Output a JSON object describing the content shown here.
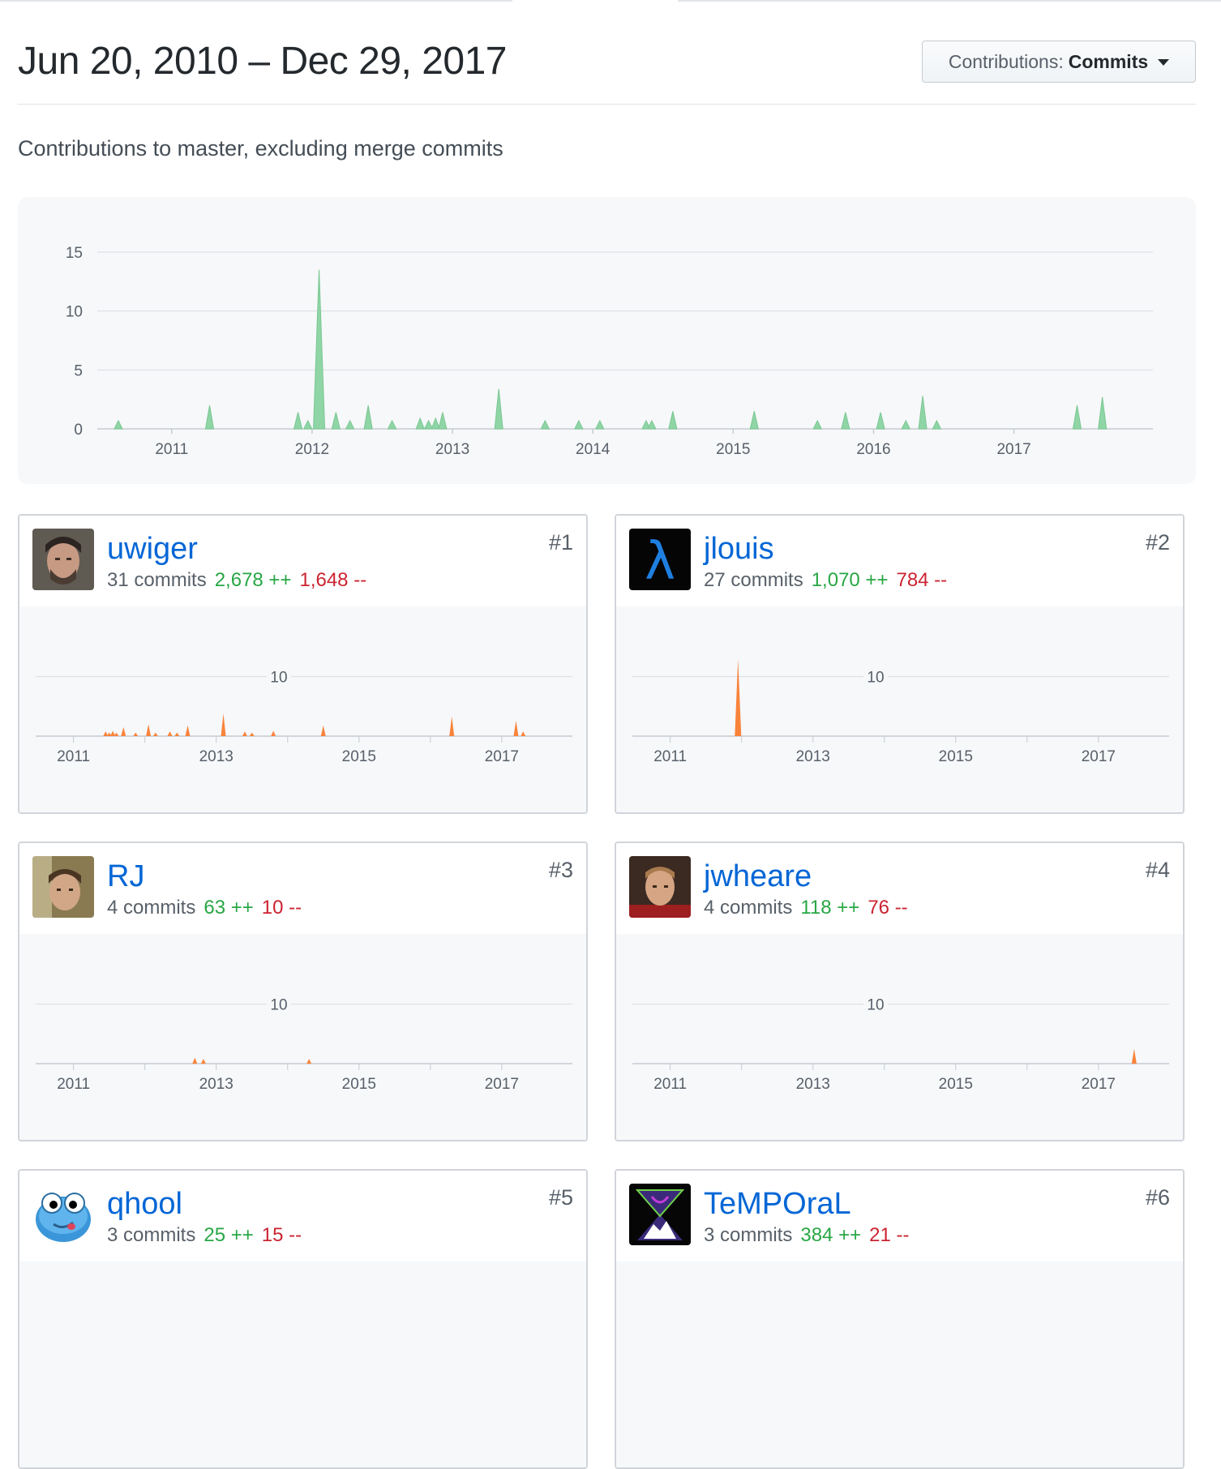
{
  "header": {
    "date_range": "Jun 20, 2010 – Dec 29, 2017",
    "select_prefix": "Contributions:",
    "select_value": "Commits",
    "subtitle": "Contributions to master, excluding merge commits"
  },
  "colors": {
    "main_area": "#8fd5a6",
    "main_stroke": "#7ac791",
    "contributor_area": "#f9833a",
    "link": "#0366d6",
    "additions": "#28a745",
    "deletions": "#cb2431"
  },
  "chart_data": [
    {
      "type": "area",
      "title": "",
      "ylim": [
        0,
        15
      ],
      "yticks": [
        0,
        5,
        10,
        15
      ],
      "xticks": [
        "2011",
        "2012",
        "2013",
        "2014",
        "2015",
        "2016",
        "2017"
      ],
      "xrange": [
        2010.47,
        2017.99
      ],
      "series": [
        {
          "x": [
            2010.62,
            2011.27,
            2011.9,
            2011.97,
            2012.05,
            2012.17,
            2012.27,
            2012.4,
            2012.57,
            2012.77,
            2012.83,
            2012.88,
            2012.93,
            2013.33,
            2013.66,
            2013.9,
            2014.05,
            2014.38,
            2014.42,
            2014.57,
            2015.15,
            2015.6,
            2015.8,
            2016.05,
            2016.23,
            2016.35,
            2016.45,
            2017.45,
            2017.63
          ],
          "y": [
            0.7,
            2,
            1.4,
            0.7,
            13.5,
            1.4,
            0.7,
            2,
            0.7,
            0.9,
            0.7,
            0.9,
            1.4,
            3.4,
            0.7,
            0.7,
            0.7,
            0.7,
            0.7,
            1.5,
            1.5,
            0.7,
            1.4,
            1.4,
            0.7,
            2.8,
            0.7,
            2,
            2.7
          ]
        }
      ]
    }
  ],
  "contributors": [
    {
      "login": "uwiger",
      "rank": "#1",
      "commits": "31 commits",
      "additions": "2,678 ++",
      "deletions": "1,648 --",
      "chart_data": {
        "type": "area",
        "ylim": [
          0,
          15
        ],
        "yticks": [
          10
        ],
        "xticks": [
          "2011",
          "2013",
          "2015",
          "2017"
        ],
        "x": [
          2011.45,
          2011.5,
          2011.55,
          2011.6,
          2011.7,
          2011.87,
          2012.05,
          2012.15,
          2012.35,
          2012.45,
          2012.6,
          2013.1,
          2013.4,
          2013.5,
          2013.8,
          2014.5,
          2016.3,
          2017.2,
          2017.3
        ],
        "y": [
          0.8,
          0.6,
          0.9,
          0.6,
          1.5,
          0.6,
          2.0,
          0.6,
          0.8,
          0.6,
          1.8,
          3.8,
          0.8,
          0.6,
          0.9,
          1.8,
          3.3,
          2.6,
          0.8
        ]
      }
    },
    {
      "login": "jlouis",
      "rank": "#2",
      "commits": "27 commits",
      "additions": "1,070 ++",
      "deletions": "784 --",
      "chart_data": {
        "type": "area",
        "ylim": [
          0,
          15
        ],
        "yticks": [
          10
        ],
        "xticks": [
          "2011",
          "2013",
          "2015",
          "2017"
        ],
        "x": [
          2011.95
        ],
        "y": [
          13
        ]
      }
    },
    {
      "login": "RJ",
      "rank": "#3",
      "commits": "4 commits",
      "additions": "63 ++",
      "deletions": "10 --",
      "chart_data": {
        "type": "area",
        "ylim": [
          0,
          15
        ],
        "yticks": [
          10
        ],
        "xticks": [
          "2011",
          "2013",
          "2015",
          "2017"
        ],
        "x": [
          2012.7,
          2012.82,
          2014.3
        ],
        "y": [
          1.0,
          0.8,
          0.8
        ]
      }
    },
    {
      "login": "jwheare",
      "rank": "#4",
      "commits": "4 commits",
      "additions": "118 ++",
      "deletions": "76 --",
      "chart_data": {
        "type": "area",
        "ylim": [
          0,
          15
        ],
        "yticks": [
          10
        ],
        "xticks": [
          "2011",
          "2013",
          "2015",
          "2017"
        ],
        "x": [
          2017.5
        ],
        "y": [
          2.5
        ]
      }
    },
    {
      "login": "qhool",
      "rank": "#5",
      "commits": "3 commits",
      "additions": "25 ++",
      "deletions": "15 --",
      "chart_data": {
        "type": "area",
        "ylim": [
          0,
          15
        ],
        "yticks": [
          10
        ],
        "xticks": [
          "2011",
          "2013",
          "2015",
          "2017"
        ],
        "x": [],
        "y": []
      }
    },
    {
      "login": "TeMPOraL",
      "rank": "#6",
      "commits": "3 commits",
      "additions": "384 ++",
      "deletions": "21 --",
      "chart_data": {
        "type": "area",
        "ylim": [
          0,
          15
        ],
        "yticks": [
          10
        ],
        "xticks": [
          "2011",
          "2013",
          "2015",
          "2017"
        ],
        "x": [],
        "y": []
      }
    }
  ]
}
